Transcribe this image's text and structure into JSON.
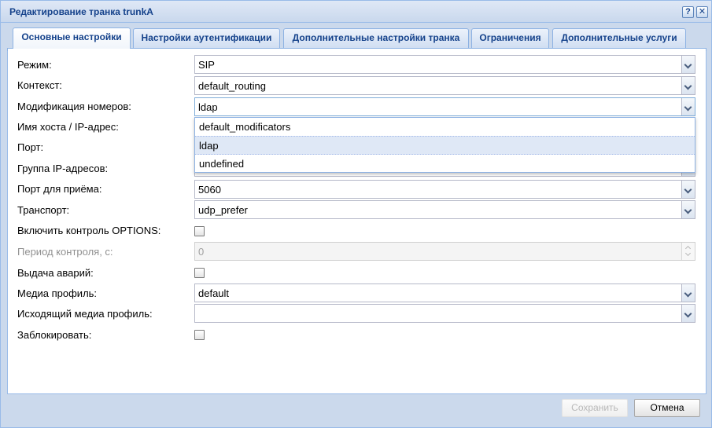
{
  "window": {
    "title": "Редактирование транка trunkA",
    "help_label": "?",
    "close_label": "✕"
  },
  "tabs": [
    {
      "label": "Основные настройки",
      "active": true
    },
    {
      "label": "Настройки аутентификации"
    },
    {
      "label": "Дополнительные настройки транка"
    },
    {
      "label": "Ограничения"
    },
    {
      "label": "Дополнительные услуги"
    }
  ],
  "form": {
    "mode": {
      "label": "Режим:",
      "value": "SIP"
    },
    "context": {
      "label": "Контекст:",
      "value": "default_routing"
    },
    "number_mod": {
      "label": "Модификация номеров:",
      "value": "ldap"
    },
    "host": {
      "label": "Имя хоста / IP-адрес:",
      "value": ""
    },
    "port": {
      "label": "Порт:",
      "value": ""
    },
    "ip_group": {
      "label": "Группа IP-адресов:",
      "value": ""
    },
    "rx_port": {
      "label": "Порт для приёма:",
      "value": "5060"
    },
    "transport": {
      "label": "Транспорт:",
      "value": "udp_prefer"
    },
    "options_ctrl": {
      "label": "Включить контроль OPTIONS:",
      "checked": false
    },
    "ctrl_period": {
      "label": "Период контроля, с:",
      "value": "0"
    },
    "alarms": {
      "label": "Выдача аварий:",
      "checked": false
    },
    "media_profile": {
      "label": "Медиа профиль:",
      "value": "default"
    },
    "out_media_profile": {
      "label": "Исходящий медиа профиль:",
      "value": ""
    },
    "block": {
      "label": "Заблокировать:",
      "checked": false
    }
  },
  "dropdown": {
    "options": [
      "default_modificators",
      "ldap",
      "undefined"
    ],
    "selected_index": 1
  },
  "buttons": {
    "save": "Сохранить",
    "cancel": "Отмена"
  }
}
